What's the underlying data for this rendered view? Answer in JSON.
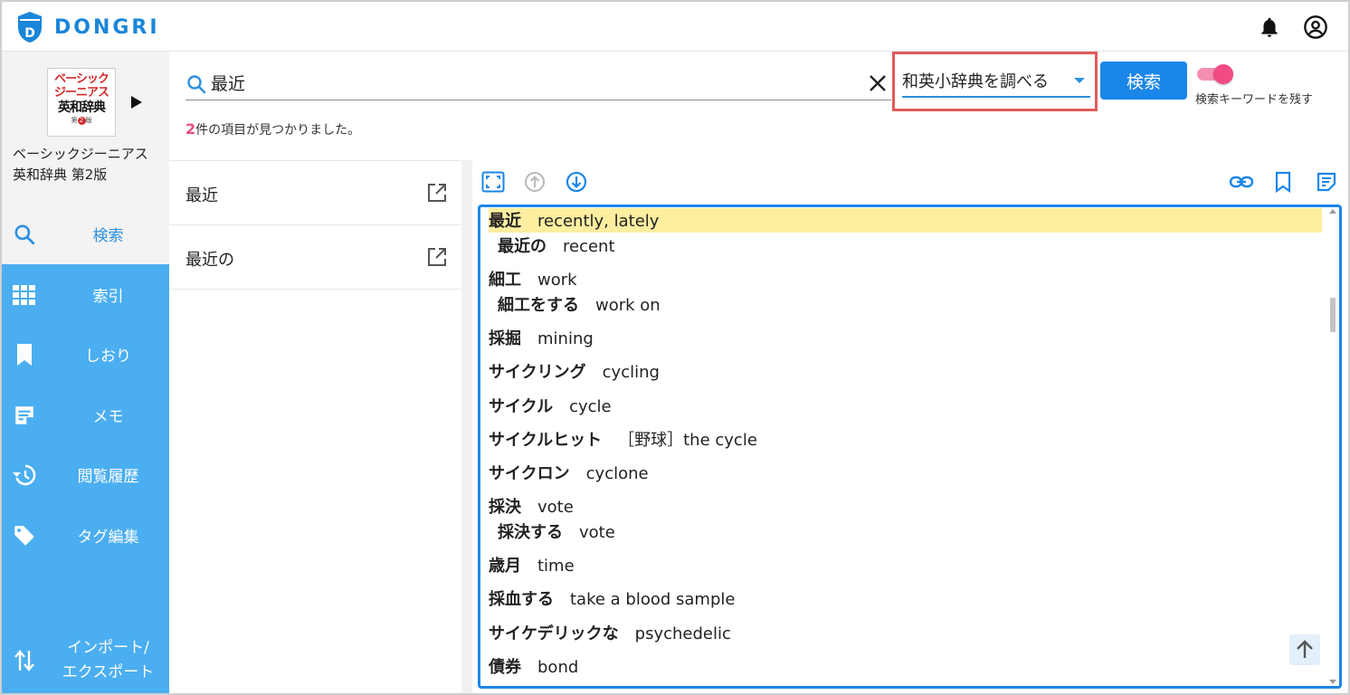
{
  "app": {
    "name": "DONGRI"
  },
  "book": {
    "cover_line1": "ベーシック",
    "cover_line2": "ジーニアス",
    "cover_line3": "英和辞典",
    "cover_edition_prefix": "第",
    "cover_edition_num": "2",
    "cover_edition_suffix": "版",
    "title_line1": "ベーシックジーニアス",
    "title_line2": "英和辞典 第2版"
  },
  "nav": {
    "items": [
      {
        "label": "検索",
        "icon": "search-icon"
      },
      {
        "label": "索引",
        "icon": "grid-icon"
      },
      {
        "label": "しおり",
        "icon": "bookmark-icon"
      },
      {
        "label": "メモ",
        "icon": "memo-icon"
      },
      {
        "label": "閲覧履歴",
        "icon": "history-icon"
      },
      {
        "label": "タグ編集",
        "icon": "tag-icon"
      }
    ],
    "import_line1": "インポート/",
    "import_line2": "エクスポート"
  },
  "search": {
    "query": "最近",
    "dictionary": "和英小辞典を調べる",
    "button": "検索",
    "keep_keyword_label": "検索キーワードを残す",
    "keep_keyword_on": true,
    "result_count": "2",
    "result_suffix": "件の項目が見つかりました。"
  },
  "results": [
    {
      "title": "最近"
    },
    {
      "title": "最近の"
    }
  ],
  "entries": [
    {
      "hw": "最近",
      "tr": "recently, lately",
      "sub": false,
      "highlight": true
    },
    {
      "hw": "最近の",
      "tr": "recent",
      "sub": true
    },
    {
      "hw": "細工",
      "tr": "work",
      "sub": false
    },
    {
      "hw": "細工をする",
      "tr": "work on",
      "sub": true
    },
    {
      "hw": "採掘",
      "tr": "mining",
      "sub": false
    },
    {
      "hw": "サイクリング",
      "tr": "cycling",
      "sub": false
    },
    {
      "hw": "サイクル",
      "tr": "cycle",
      "sub": false
    },
    {
      "hw": "サイクルヒット",
      "tr": "［野球］the cycle",
      "sub": false
    },
    {
      "hw": "サイクロン",
      "tr": "cyclone",
      "sub": false
    },
    {
      "hw": "採決",
      "tr": "vote",
      "sub": false
    },
    {
      "hw": "採決する",
      "tr": "vote",
      "sub": true
    },
    {
      "hw": "歳月",
      "tr": "time",
      "sub": false
    },
    {
      "hw": "採血する",
      "tr": "take a blood sample",
      "sub": false
    },
    {
      "hw": "サイケデリックな",
      "tr": "psychedelic",
      "sub": false
    },
    {
      "hw": "債券",
      "tr": "bond",
      "sub": false
    }
  ],
  "colors": {
    "accent": "#1a86e8",
    "nav_bg": "#4baef0",
    "highlight": "#fdeea0",
    "count": "#ea4d7d",
    "toggle": "#f24a84"
  }
}
